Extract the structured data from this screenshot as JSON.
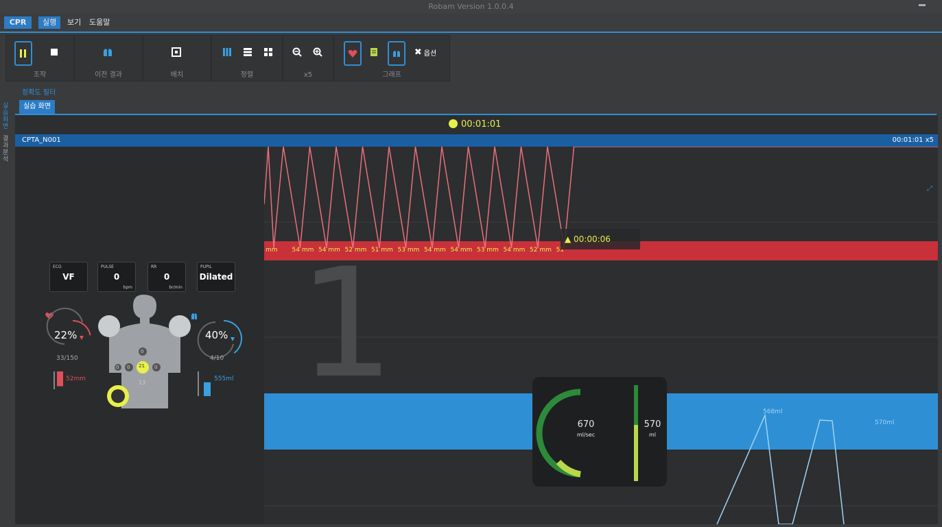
{
  "app": {
    "title": "Robam Version 1.0.0.4"
  },
  "menu": {
    "app_label": "CPR",
    "items": [
      "실행",
      "보기",
      "도움말"
    ]
  },
  "ribbon": {
    "groups": [
      {
        "label": "조작"
      },
      {
        "label": "이전 결과"
      },
      {
        "label": "배치"
      },
      {
        "label": "정렬"
      },
      {
        "label": "x5"
      },
      {
        "label": "그래프"
      }
    ],
    "option_label": "옵션"
  },
  "sublabel": "정확도 필터",
  "tabs": [
    "실습 화면"
  ],
  "sidebar": {
    "text_1": "실습 화면",
    "text_2": "결과 분석"
  },
  "timer": "00:01:01",
  "session": {
    "id": "CPTA_N001",
    "time": "00:01:01 x5"
  },
  "vitals": [
    {
      "label": "ECG",
      "value": "VF",
      "unit": ""
    },
    {
      "label": "PULSE",
      "value": "0",
      "unit": "bpm"
    },
    {
      "label": "RR",
      "value": "0",
      "unit": "br/min"
    },
    {
      "label": "PUPIL",
      "value": "Dilated",
      "unit": ""
    }
  ],
  "compression": {
    "percent": "22%",
    "count": "33/150",
    "depth": "52mm",
    "depth_fill": 0.6,
    "percent_fill": 0.22
  },
  "ventilation": {
    "percent": "40%",
    "count": "4/10",
    "volume": "555ml",
    "volume_fill": 0.45,
    "percent_fill": 0.4
  },
  "body": {
    "cycle": "21",
    "count": "13",
    "nodes": [
      "0",
      "0",
      "0",
      "0"
    ]
  },
  "compression_labels": [
    "mm",
    "54 mm",
    "54 mm",
    "52 mm",
    "51 mm",
    "53 mm",
    "54 mm",
    "54 mm",
    "53 mm",
    "54 mm",
    "52 mm",
    "51"
  ],
  "warning": "00:00:06",
  "big_number": "1",
  "flow": {
    "rate": "670",
    "rate_unit": "ml/sec",
    "volume": "570",
    "volume_unit": "ml"
  },
  "vent_labels": [
    "568ml",
    "570ml"
  ],
  "colors": {
    "accent": "#2f8fd4",
    "compression": "#e05058",
    "ventilation": "#3aa0e0",
    "highlight": "#e8f04a"
  }
}
